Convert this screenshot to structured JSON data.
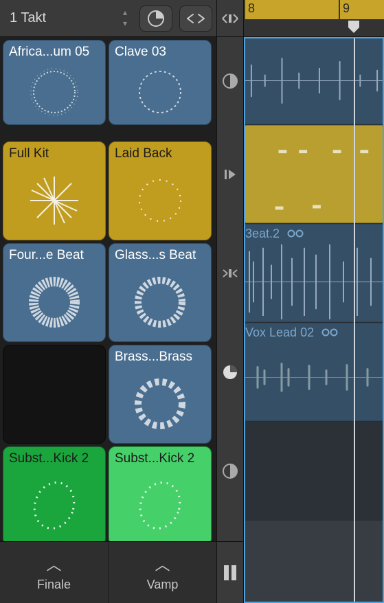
{
  "toolbar": {
    "takt_label": "1 Takt"
  },
  "cells": {
    "r0c0": "Africa...um 05",
    "r0c1": "Clave 03",
    "r1c0": "Full Kit",
    "r1c1": "Laid Back",
    "r2c0": "Four...e Beat",
    "r2c1": "Glass...s Beat",
    "r3c1": "Brass...Brass",
    "r4c0": "Subst...Kick 2",
    "r4c1": "Subst...Kick 2"
  },
  "song_nav": {
    "left": "Finale",
    "right": "Vamp"
  },
  "ruler": {
    "bar_left": "8",
    "bar_right": "9"
  },
  "lanes": {
    "lane2_label": "3eat.2",
    "lane2_loop": "♾",
    "lane3_label": "Vox Lead 02",
    "lane3_loop": "♾"
  },
  "colors": {
    "blue": "#4a6e8f",
    "yellow": "#c19d1f",
    "green": "#1aa53d",
    "green_lit": "#46d06a"
  }
}
